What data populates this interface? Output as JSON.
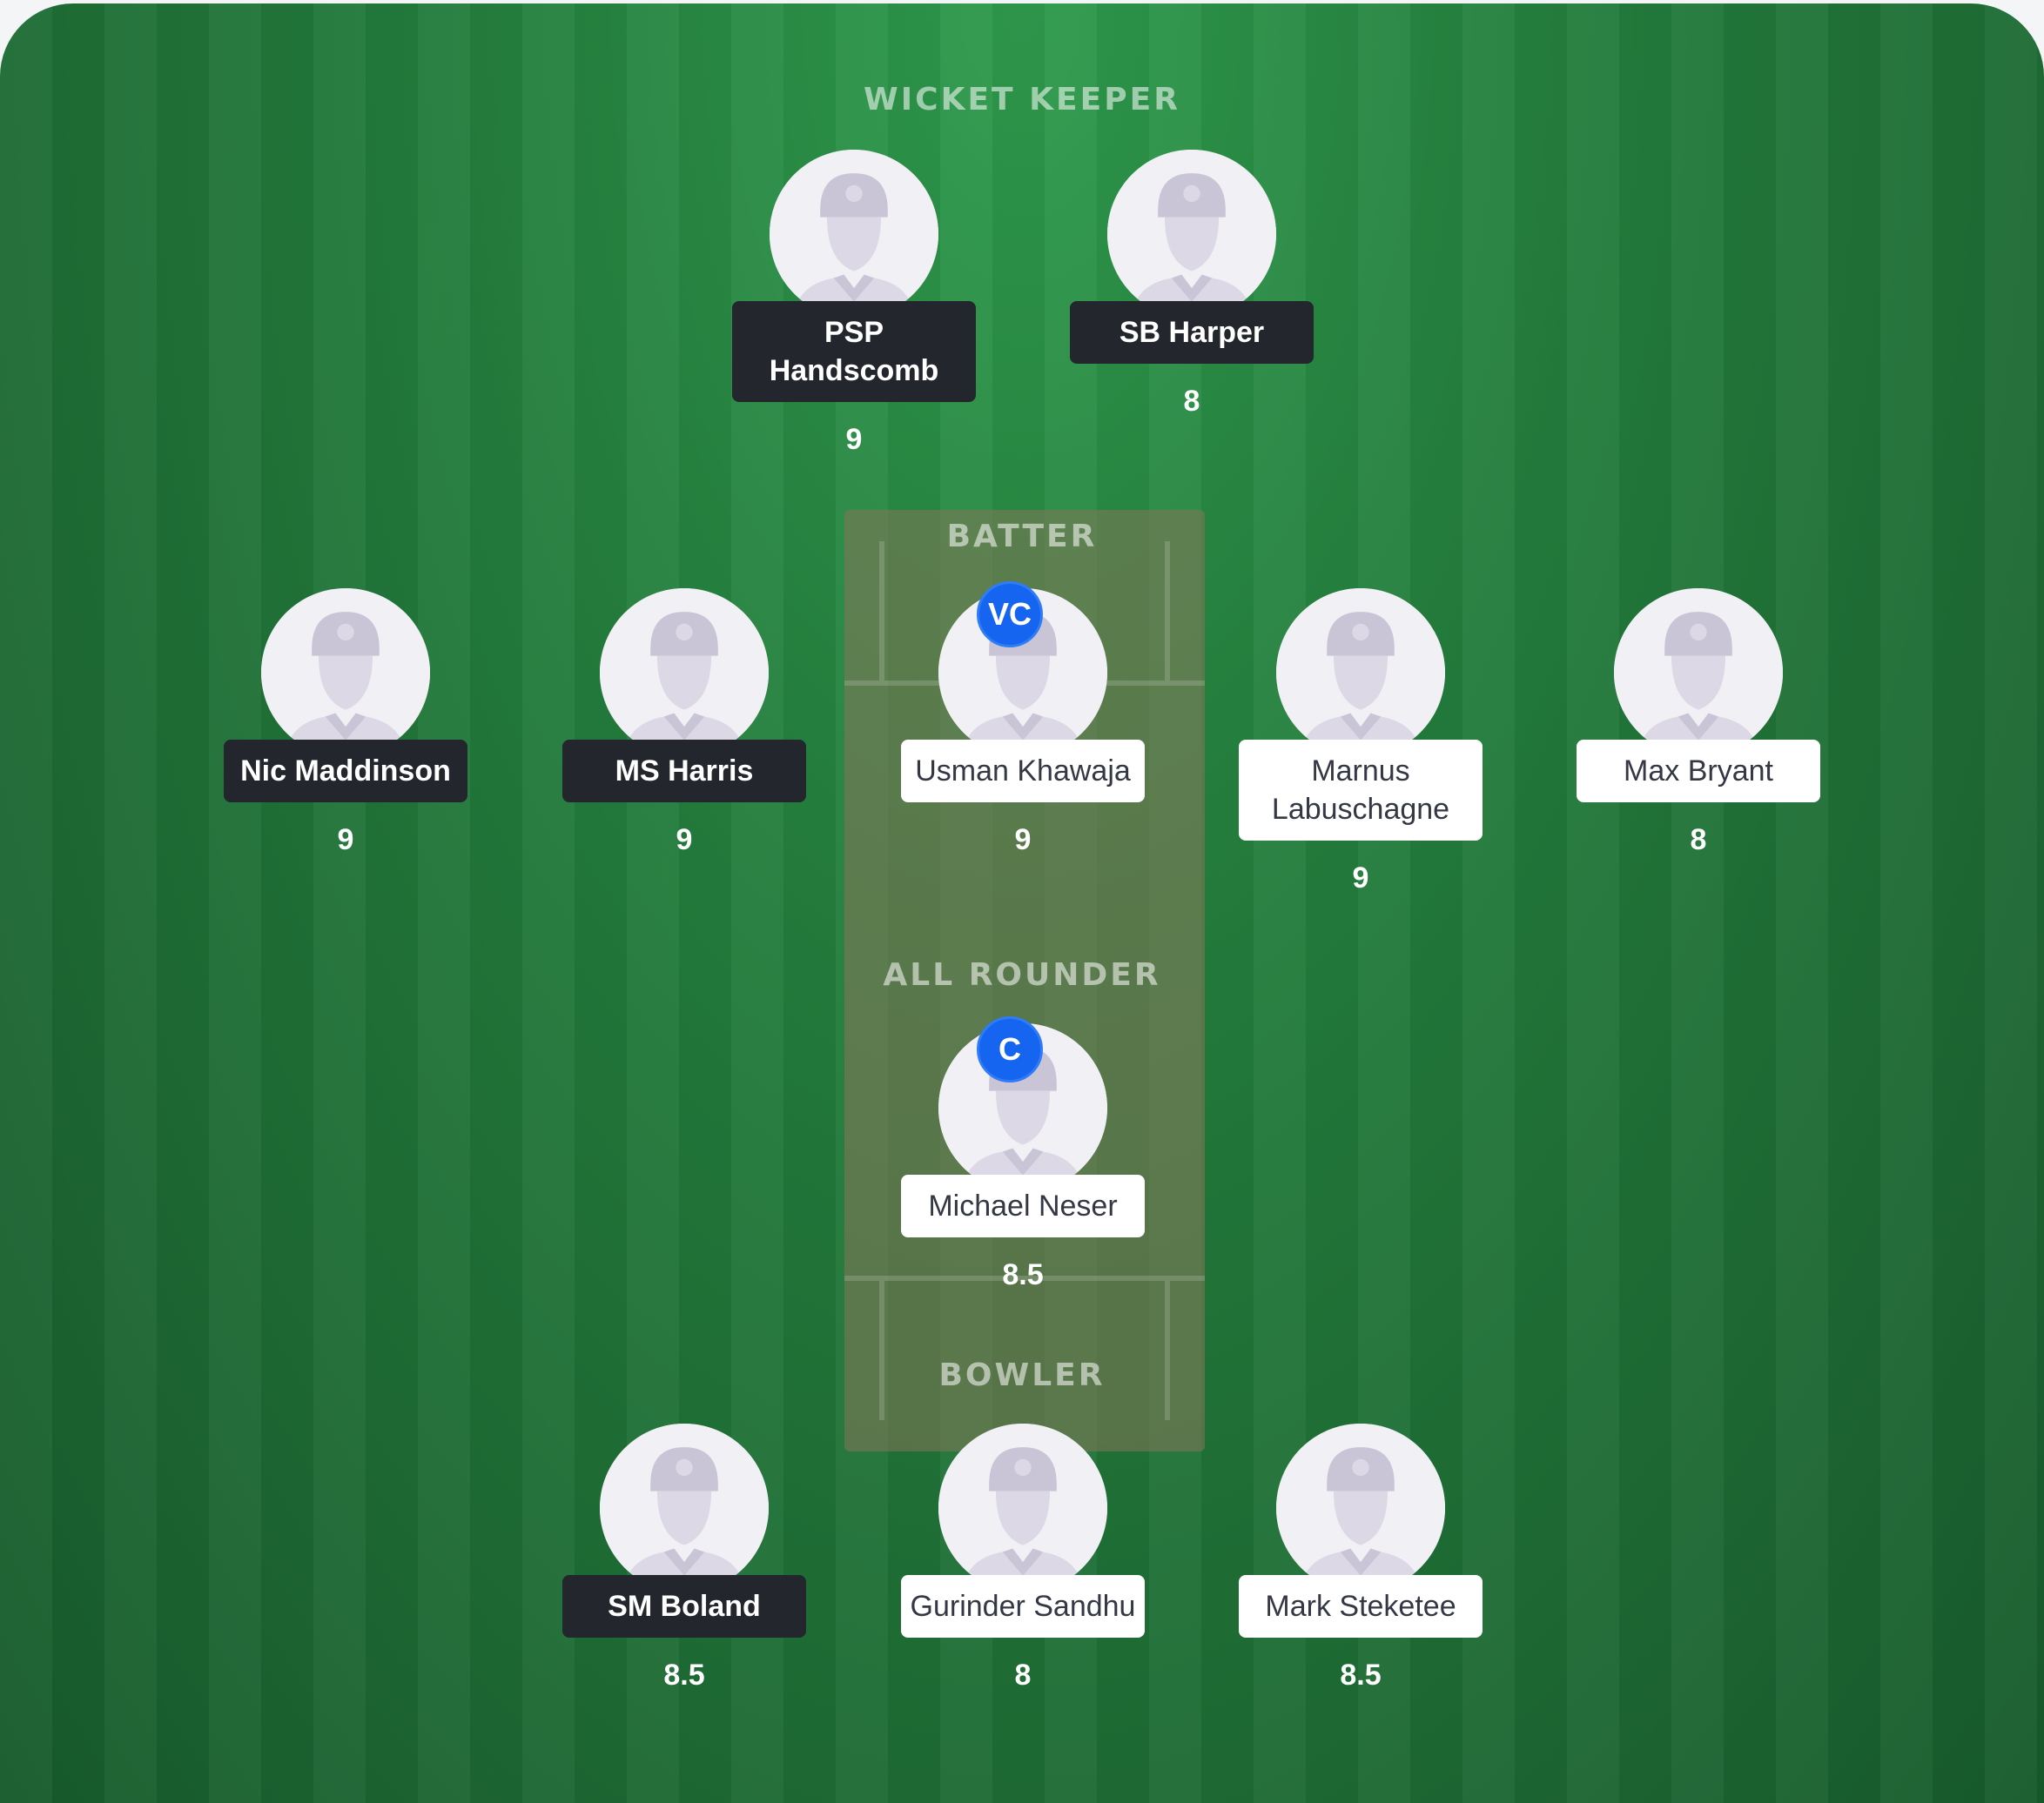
{
  "sections": {
    "wicket_keeper": "WICKET KEEPER",
    "batter": "BATTER",
    "all_rounder": "ALL ROUNDER",
    "bowler": "BOWLER"
  },
  "colors": {
    "field_green": "#237c3c",
    "pitch_brown": "#857657",
    "dark_tag": "#23262d",
    "light_tag": "#ffffff",
    "badge_blue": "#1565f0"
  },
  "players": {
    "wk1": {
      "name": "PSP Handscomb",
      "points": "9",
      "tag_style": "dark"
    },
    "wk2": {
      "name": "SB Harper",
      "points": "8",
      "tag_style": "dark"
    },
    "bat1": {
      "name": "Nic Maddinson",
      "points": "9",
      "tag_style": "dark"
    },
    "bat2": {
      "name": "MS Harris",
      "points": "9",
      "tag_style": "dark"
    },
    "bat3": {
      "name": "Usman Khawaja",
      "points": "9",
      "tag_style": "light",
      "badge": "VC"
    },
    "bat4": {
      "name": "Marnus Labuschagne",
      "points": "9",
      "tag_style": "light"
    },
    "bat5": {
      "name": "Max Bryant",
      "points": "8",
      "tag_style": "light"
    },
    "ar1": {
      "name": "Michael Neser",
      "points": "8.5",
      "tag_style": "light",
      "badge": "C"
    },
    "bowl1": {
      "name": "SM Boland",
      "points": "8.5",
      "tag_style": "dark"
    },
    "bowl2": {
      "name": "Gurinder Sandhu",
      "points": "8",
      "tag_style": "light"
    },
    "bowl3": {
      "name": "Mark Steketee",
      "points": "8.5",
      "tag_style": "light"
    }
  },
  "icons": {
    "avatar": "player-silhouette-icon"
  }
}
